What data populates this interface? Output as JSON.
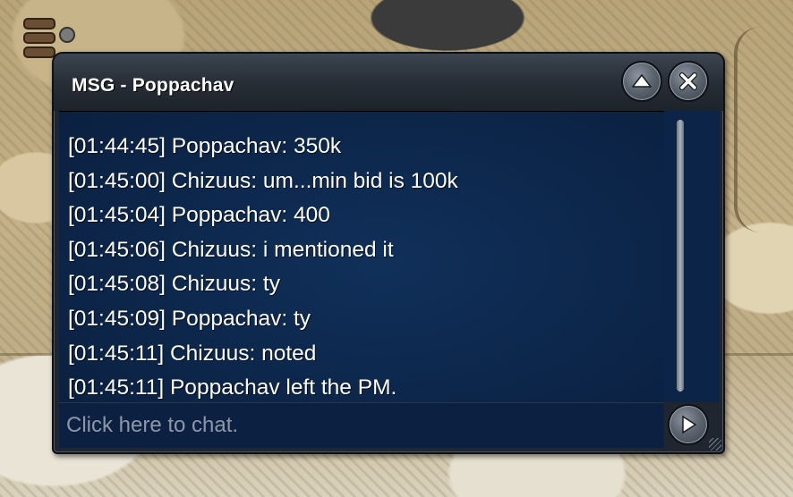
{
  "window": {
    "title": "MSG - Poppachav",
    "buttons": {
      "minimize_icon": "chevron-up-icon",
      "close_icon": "close-icon",
      "send_icon": "play-icon"
    }
  },
  "messages": [
    "[01:44:45] Poppachav: 350k",
    "[01:45:00] Chizuus: um...min bid is 100k",
    "[01:45:04] Poppachav: 400",
    "[01:45:06] Chizuus: i mentioned it",
    "[01:45:08] Chizuus: ty",
    "[01:45:09] Poppachav: ty",
    "[01:45:11] Chizuus: noted",
    "[01:45:11] Poppachav left the PM."
  ],
  "chat": {
    "placeholder": "Click here to chat.",
    "value": ""
  },
  "colors": {
    "message_bg": "#0c2447",
    "title_bar": "#272e37",
    "text": "#ffffff",
    "placeholder": "#8d97a7"
  }
}
